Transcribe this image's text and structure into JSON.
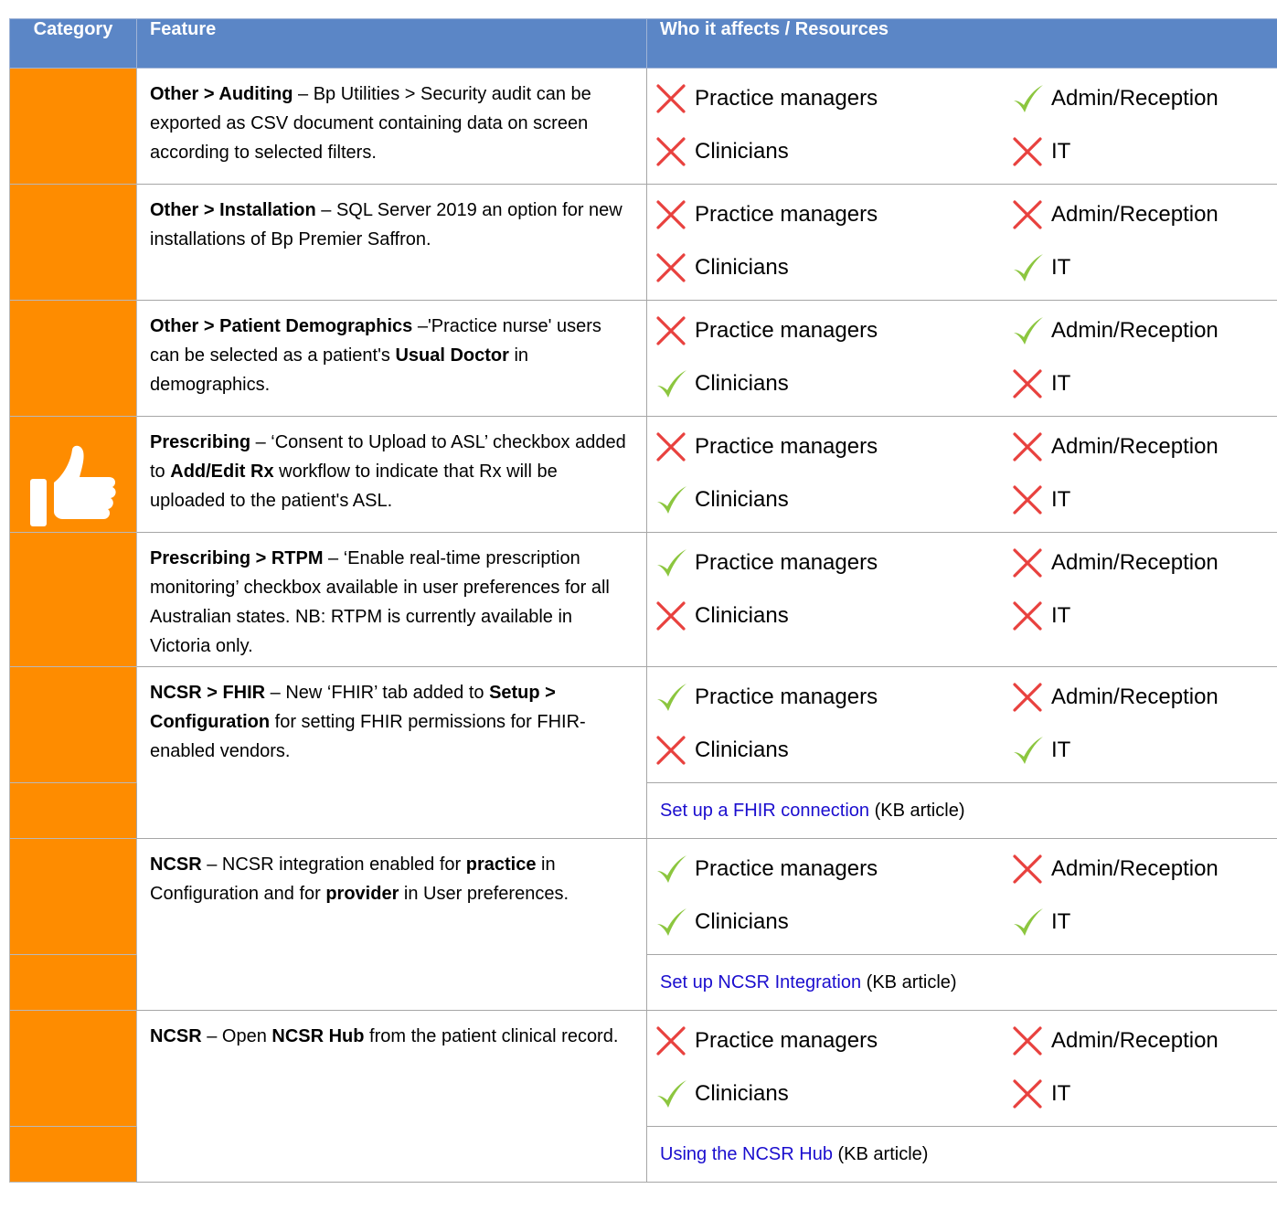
{
  "header": {
    "category": "Category",
    "feature": "Feature",
    "who": "Who it affects / Resources"
  },
  "roles": {
    "pm": "Practice managers",
    "admin": "Admin/Reception",
    "clin": "Clinicians",
    "it": "IT"
  },
  "rows": [
    {
      "feature_parts": [
        [
          "b",
          "Other > Auditing"
        ],
        [
          "t",
          " – Bp Utilities > Security audit can be exported as CSV document containing data on screen according to selected filters."
        ]
      ],
      "pm": false,
      "admin": true,
      "clin": false,
      "it": false
    },
    {
      "feature_parts": [
        [
          "b",
          "Other > Installation"
        ],
        [
          "t",
          " – SQL Server 2019 an option for new installations of Bp Premier Saffron."
        ]
      ],
      "pm": false,
      "admin": false,
      "clin": false,
      "it": true
    },
    {
      "feature_parts": [
        [
          "b",
          "Other > Patient Demographics"
        ],
        [
          "t",
          " –'Practice nurse' users can be selected as a patient's "
        ],
        [
          "b",
          "Usual Doctor"
        ],
        [
          "t",
          " in demographics."
        ]
      ],
      "pm": false,
      "admin": true,
      "clin": true,
      "it": false
    },
    {
      "feature_parts": [
        [
          "b",
          "Prescribing"
        ],
        [
          "t",
          " – ‘Consent to Upload to ASL’ checkbox added to "
        ],
        [
          "b",
          "Add/Edit Rx"
        ],
        [
          "t",
          " workflow to indicate that Rx will be uploaded to the patient's ASL."
        ]
      ],
      "pm": false,
      "admin": false,
      "clin": true,
      "it": false,
      "thumb": true
    },
    {
      "feature_parts": [
        [
          "b",
          "Prescribing > RTPM"
        ],
        [
          "t",
          " – ‘Enable real-time prescription monitoring’ checkbox available in user preferences for all Australian states. NB: RTPM is currently available in Victoria only."
        ]
      ],
      "pm": true,
      "admin": false,
      "clin": false,
      "it": false
    },
    {
      "feature_parts": [
        [
          "b",
          "NCSR > FHIR"
        ],
        [
          "t",
          " – New ‘FHIR’ tab added to "
        ],
        [
          "b",
          "Setup > Configuration"
        ],
        [
          "t",
          " for setting FHIR permissions for FHIR-enabled vendors."
        ]
      ],
      "pm": true,
      "admin": false,
      "clin": false,
      "it": true,
      "resource": {
        "link": "Set up a FHIR connection",
        "suffix": " (KB article)"
      }
    },
    {
      "feature_parts": [
        [
          "b",
          "NCSR"
        ],
        [
          "t",
          " – NCSR integration enabled for "
        ],
        [
          "b",
          "practice"
        ],
        [
          "t",
          " in Configuration and for "
        ],
        [
          "b",
          "provider"
        ],
        [
          "t",
          " in User preferences."
        ]
      ],
      "pm": true,
      "admin": false,
      "clin": true,
      "it": true,
      "resource": {
        "link": "Set up NCSR Integration",
        "suffix": " (KB article)"
      }
    },
    {
      "feature_parts": [
        [
          "b",
          "NCSR"
        ],
        [
          "t",
          " – Open "
        ],
        [
          "b",
          "NCSR Hub"
        ],
        [
          "t",
          " from the patient clinical record."
        ]
      ],
      "pm": false,
      "admin": false,
      "clin": true,
      "it": false,
      "resource": {
        "link": "Using the NCSR Hub",
        "suffix": " (KB article)"
      }
    }
  ],
  "colors": {
    "header": "#5b86c6",
    "category": "#fe8c00",
    "check": "#8cc63f",
    "cross": "#e8413e",
    "link": "#1a0dce"
  },
  "icons": {
    "yes": "check-icon",
    "no": "cross-icon",
    "category": "thumbs-up-icon"
  }
}
